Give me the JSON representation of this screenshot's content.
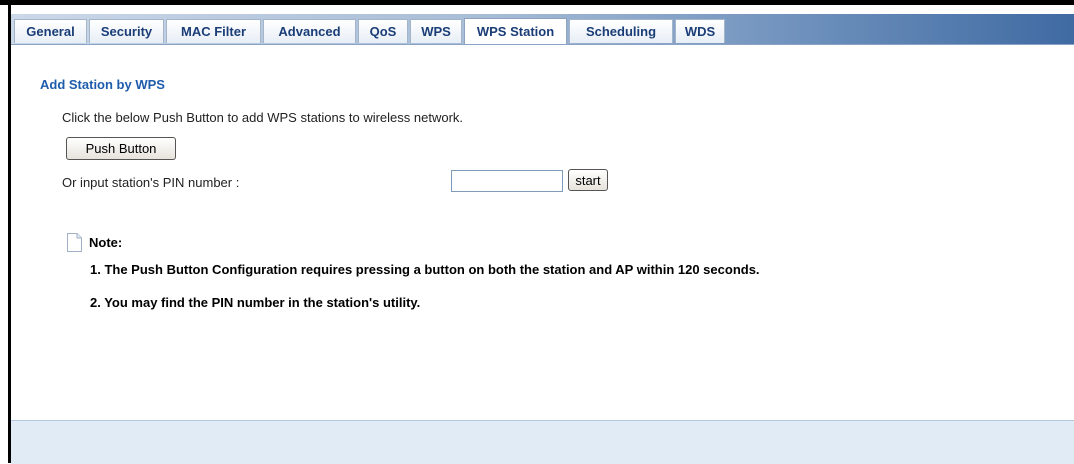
{
  "tabs": [
    {
      "label": "General"
    },
    {
      "label": "Security"
    },
    {
      "label": "MAC Filter"
    },
    {
      "label": "Advanced"
    },
    {
      "label": "QoS"
    },
    {
      "label": "WPS"
    },
    {
      "label": "WPS Station",
      "active": true
    },
    {
      "label": "Scheduling"
    },
    {
      "label": "WDS"
    }
  ],
  "section": {
    "title": "Add Station by WPS",
    "instruction": "Click the below Push Button to add WPS stations to wireless network.",
    "push_button_label": "Push Button",
    "pin_label": "Or input station's PIN number :",
    "pin_value": "",
    "start_label": "start"
  },
  "note": {
    "label": "Note:",
    "icon": "note-page-icon",
    "items": [
      "1. The Push Button Configuration requires pressing a button on both the station and AP within 120 seconds.",
      "2. You may find the PIN number in the station's utility."
    ]
  },
  "colors": {
    "tab_text": "#1a3d77",
    "section_title": "#1f5cac",
    "bottom_bar": "#e0ebf6"
  }
}
